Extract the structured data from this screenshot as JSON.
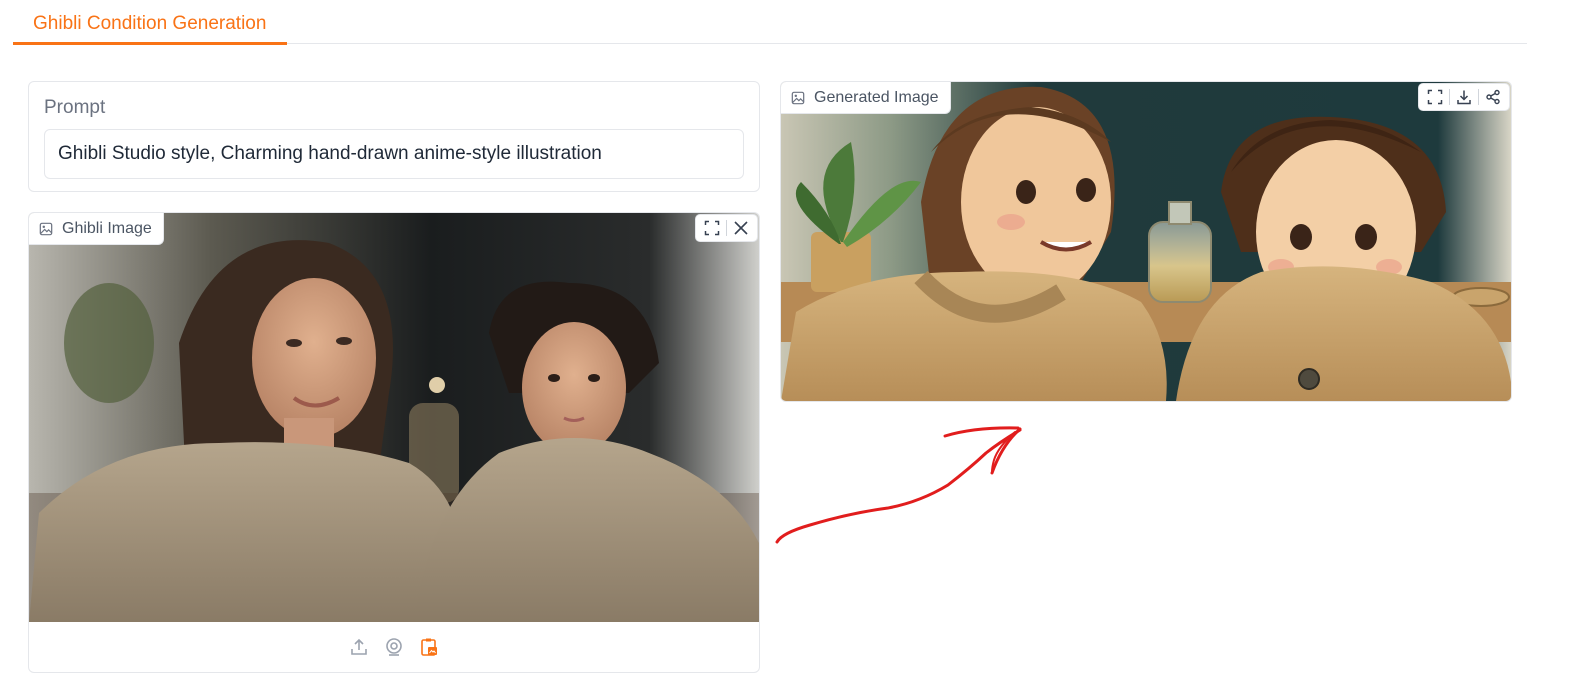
{
  "tabs": [
    {
      "label": "Ghibli Condition Generation",
      "active": true
    }
  ],
  "prompt": {
    "label": "Prompt",
    "value": "Ghibli Studio style, Charming hand-drawn anime-style illustration"
  },
  "input_image": {
    "label": "Ghibli Image",
    "label_icon": "image-icon",
    "toolbar": [
      "fullscreen-icon",
      "close-icon"
    ],
    "footer_icons": [
      "upload-icon",
      "webcam-icon",
      "clipboard-icon"
    ]
  },
  "output_image": {
    "label": "Generated Image",
    "label_icon": "image-icon",
    "toolbar": [
      "fullscreen-icon",
      "download-icon",
      "share-icon"
    ]
  },
  "colors": {
    "accent": "#f97316",
    "border": "#e5e7eb",
    "annotation_arrow": "#e11d1d"
  }
}
